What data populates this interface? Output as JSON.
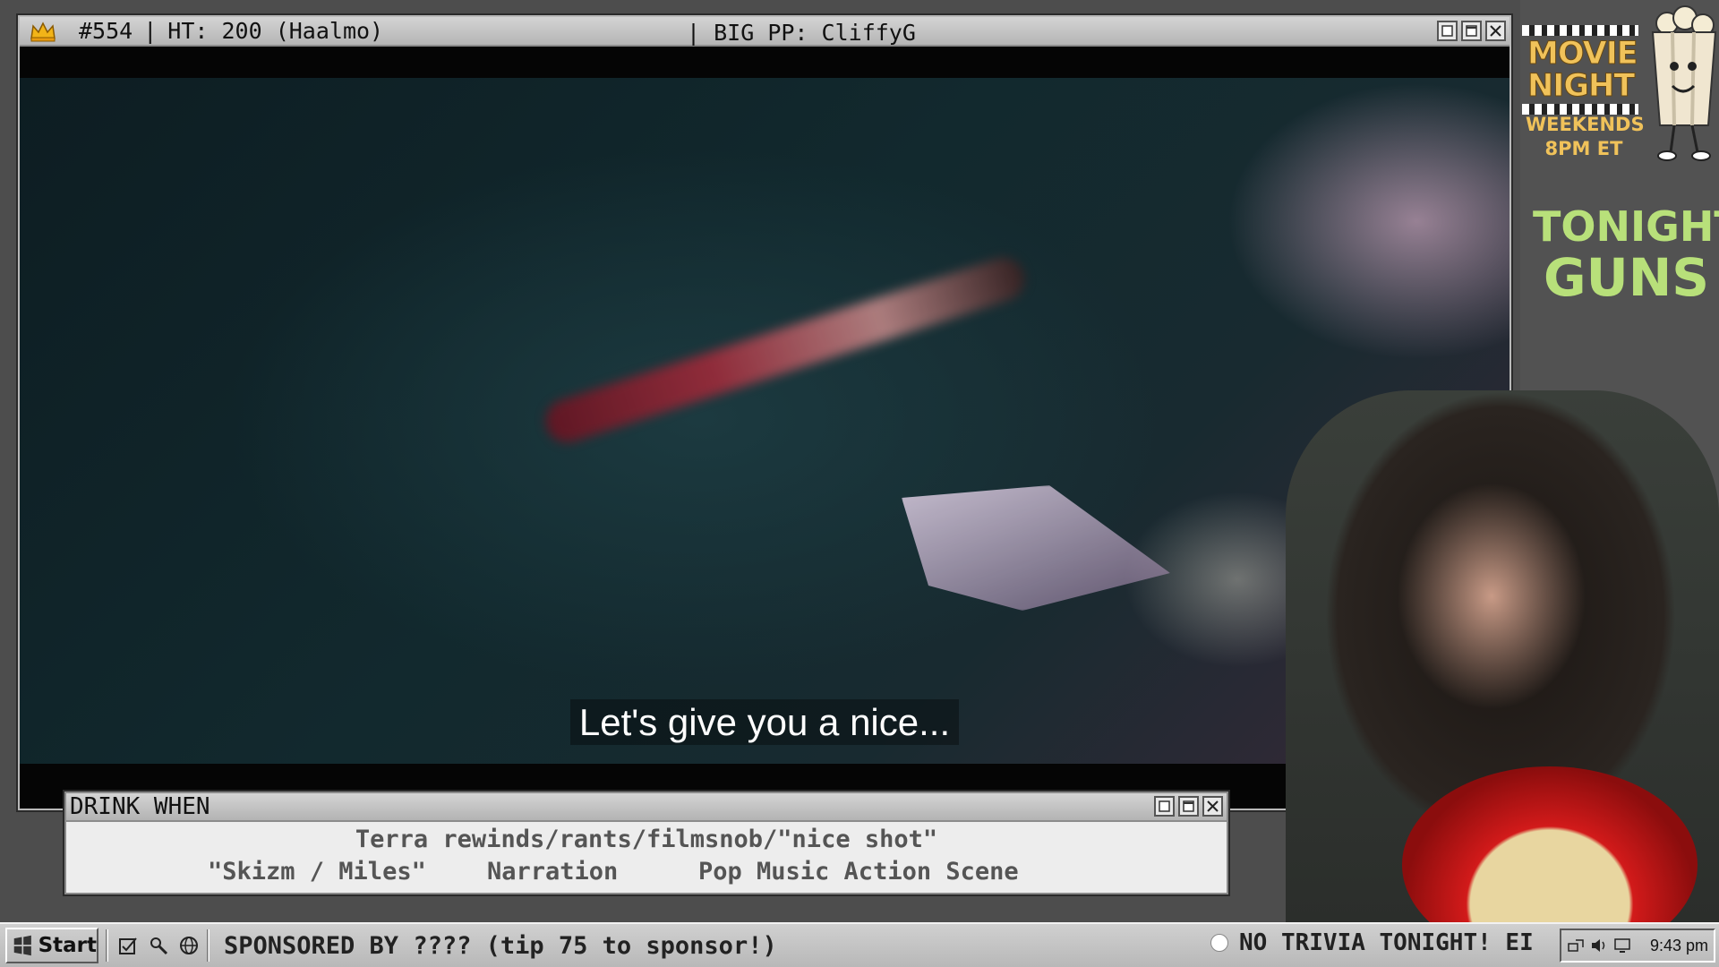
{
  "main_window": {
    "episode": "#554",
    "sep1": "|",
    "ht_text": "HT: 200 (Haalmo)",
    "sep2": "|",
    "pp_text": "BIG PP: CliffyG",
    "crown_icon": "crown-icon"
  },
  "video": {
    "subtitle": "Let's give you a nice..."
  },
  "drink_window": {
    "title": "DRINK WHEN",
    "line1": "Terra rewinds/rants/filmsnob/\"nice shot\"",
    "items": [
      "\"Skizm / Miles\"",
      "Narration",
      "Pop Music Action Scene"
    ]
  },
  "sidebar": {
    "logo_line1": "MOVIE",
    "logo_line2": "NIGHT",
    "schedule_line1": "WEEKENDS",
    "schedule_line2": "8PM ET",
    "tonight_label": "TONIGHT:",
    "tonight_movie": "GUNS A",
    "accent_color": "#b8e07a",
    "logo_color": "#f0c25a"
  },
  "taskbar": {
    "start_label": "Start",
    "sponsor_text": "SPONSORED BY ???? (tip 75 to sponsor!)",
    "ticker_text": "NO TRIVIA TONIGHT! EI",
    "clock": "9:43 pm"
  }
}
